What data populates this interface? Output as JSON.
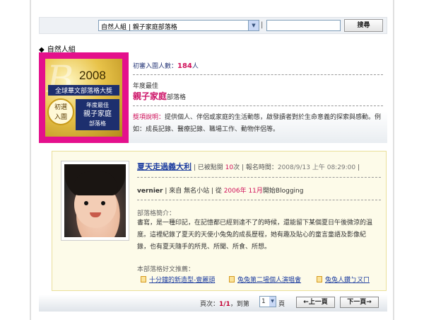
{
  "search": {
    "category_value": "自然人組 | 親子家庭部落格",
    "separator": "|",
    "input_value": "",
    "button_label": "搜尋"
  },
  "category_header": {
    "diamond": "◆",
    "label": "自然人組"
  },
  "award": {
    "badge": {
      "b_letter": "B",
      "year": "2008",
      "subtitle": "全球華文部落格大獎",
      "seal_line1": "初選",
      "seal_line2": "入圍",
      "plate_line1": "年度最佳",
      "plate_line2": "親子家庭",
      "plate_line3": "部落格"
    },
    "entries_label": "初審入圍人數：",
    "entries_count": "184",
    "entries_unit": "人",
    "year_best": "年度最佳",
    "category_bold": "親子家庭",
    "category_suffix": "部落格",
    "desc_label": "獎項說明：",
    "desc_text": "提供個人、伴侶或家庭的生活動態，啟發讀者對於生命意義的探索與感動。例如：成長記錄、醫療記錄、職場工作、動物伴侶等。"
  },
  "entry": {
    "title": "夏天走過義大利",
    "clicks_prefix": " | 已被點閱 ",
    "clicks_count": "10",
    "clicks_suffix": "次 | 報名時間：",
    "pub_time": "2008/9/13 上午 08:29:00",
    "pub_end": " |",
    "author": "vernier",
    "source": " | 來自 無名小站 | 從 ",
    "start_year": "2006年",
    "start_month": " 11月",
    "start_suffix": "開始Blogging",
    "intro_label": "部落格簡介：",
    "intro_text": "書寫，是一種印記，在記憶都已經到達不了的時候，還能留下某個夏日午後微涼的溫度。這裡紀錄了夏天的天使小兔兔的成長歷程，她有趣及貼心的童言童語及影像紀錄，也有夏天隨手的所見、所聞、所食、所想。",
    "rec_label": "本部落格好文推薦：",
    "recommendations": [
      "十分鐘的新造型-壹麗頭",
      "兔兔第二場個人演唱會",
      "兔兔人鑽ㄅㄡㄇ"
    ]
  },
  "pager": {
    "label": "頁次：",
    "current": "1/1",
    "goto_label": "，到第",
    "select_value": "1",
    "page_unit": "頁",
    "prev_label": "←上一頁",
    "next_label": "下一頁→"
  }
}
